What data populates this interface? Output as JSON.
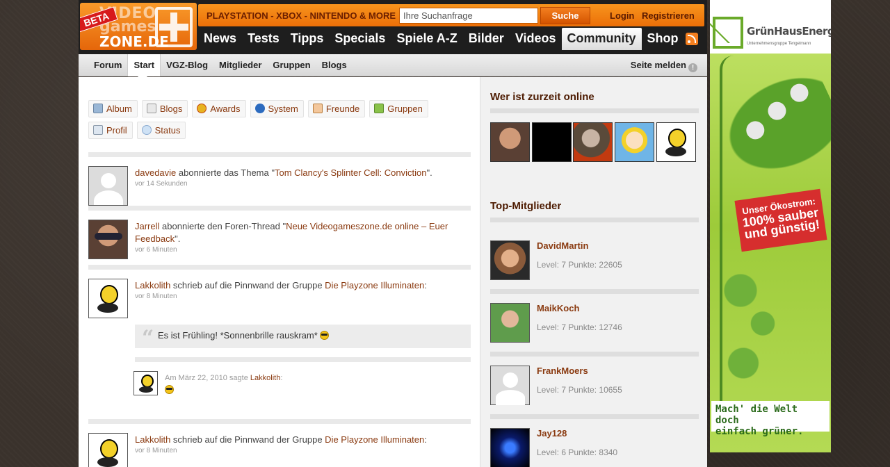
{
  "header": {
    "beta": "BETA",
    "logo_line1": "VIDEO",
    "logo_line2": "games",
    "logo_line3": "ZONE.DE",
    "platforms": "PLAYSTATION - XBOX - NINTENDO & MORE",
    "search_value": "Ihre Suchanfrage",
    "search_button": "Suche",
    "login": "Login",
    "register": "Registrieren",
    "nav": [
      "News",
      "Tests",
      "Tipps",
      "Specials",
      "Spiele A-Z",
      "Bilder",
      "Videos",
      "Community",
      "Shop"
    ],
    "nav_active": "Community"
  },
  "subnav": {
    "items": [
      "Forum",
      "Start",
      "VGZ-Blog",
      "Mitglieder",
      "Gruppen",
      "Blogs"
    ],
    "active": "Start",
    "report": "Seite melden"
  },
  "activity_tabs": {
    "row1": [
      "Album",
      "Blogs",
      "Awards",
      "System",
      "Freunde",
      "Gruppen"
    ],
    "row2": [
      "Profil",
      "Status"
    ]
  },
  "feed": [
    {
      "user": "davedavie",
      "action": " abonnierte das Thema \"",
      "target": "Tom Clancy's Splinter Cell: Conviction",
      "end": "\".",
      "time": "vor 14 Sekunden"
    },
    {
      "user": "Jarrell",
      "action": " abonnierte den Foren-Thread \"",
      "target": "Neue Videogameszone.de online – Euer Feedback",
      "end": "\".",
      "time": "vor 6 Minuten"
    },
    {
      "user": "Lakkolith",
      "action": " schrieb auf die Pinnwand der Gruppe ",
      "target": "Die Playzone Illuminaten",
      "end": ":",
      "time": "vor 8 Minuten",
      "quote": "Es ist Frühling! *Sonnenbrille rauskram*",
      "comment_meta": "Am März 22, 2010 sagte ",
      "comment_user": "Lakkolith",
      "comment_end": ":"
    },
    {
      "user": "Lakkolith",
      "action": " schrieb auf die Pinnwand der Gruppe ",
      "target": "Die Playzone Illuminaten",
      "end": ":",
      "time": "vor 8 Minuten"
    }
  ],
  "sidebar": {
    "online_title": "Wer ist zurzeit online",
    "top_title": "Top-Mitglieder",
    "members": [
      {
        "name": "DavidMartin",
        "level": "Level: 7 Punkte: 22605"
      },
      {
        "name": "MaikKoch",
        "level": "Level: 7 Punkte: 12746"
      },
      {
        "name": "FrankMoers",
        "level": "Level: 7 Punkte: 10655"
      },
      {
        "name": "Jay128",
        "level": "Level: 6 Punkte: 8340"
      }
    ]
  },
  "ad": {
    "brand": "GrünHausEnergie",
    "sub": "Unternehmensgruppe Tengelmann",
    "badge_1": "Unser Ökostrom:",
    "badge_2": "100% sauber",
    "badge_3": "und günstig!",
    "bottom_1": "Mach' die Welt doch",
    "bottom_2": "einfach grüner."
  },
  "colors": {
    "accent_orange": "#f7941d",
    "link_brown": "#8a3a10",
    "header_dark": "#1e1e1e"
  }
}
